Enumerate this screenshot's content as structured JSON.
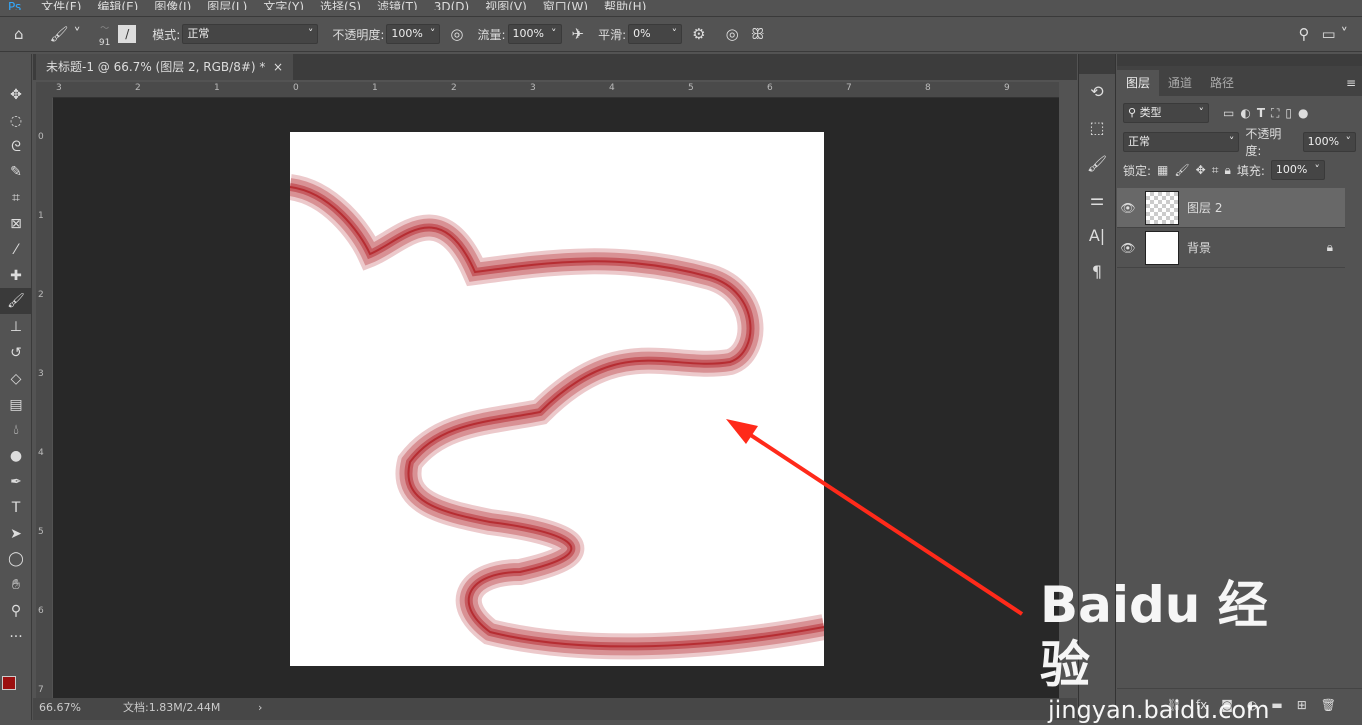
{
  "menu": [
    "文件(F)",
    "编辑(E)",
    "图像(I)",
    "图层(L)",
    "文字(Y)",
    "选择(S)",
    "滤镜(T)",
    "3D(D)",
    "视图(V)",
    "窗口(W)",
    "帮助(H)"
  ],
  "options": {
    "brush_size": "91",
    "mode_label": "模式:",
    "mode_value": "正常",
    "opacity_label": "不透明度:",
    "opacity_value": "100%",
    "flow_label": "流量:",
    "flow_value": "100%",
    "smooth_label": "平滑:",
    "smooth_value": "0%"
  },
  "document": {
    "tab_title": "未标题-1 @ 66.7% (图层 2, RGB/8#) *",
    "close": "×"
  },
  "rulers": {
    "h": [
      "3",
      "2",
      "1",
      "0",
      "1",
      "2",
      "3",
      "4",
      "5",
      "6",
      "7",
      "8",
      "9"
    ],
    "v": [
      "0",
      "1",
      "2",
      "3",
      "4",
      "5",
      "6",
      "7"
    ]
  },
  "status": {
    "zoom": "66.67%",
    "doc": "文档:1.83M/2.44M",
    "arrow": "›"
  },
  "layers_panel": {
    "tabs": [
      "图层",
      "通道",
      "路径"
    ],
    "filter": "类型",
    "blend": "正常",
    "opacity_label": "不透明度:",
    "opacity": "100%",
    "lock_label": "锁定:",
    "fill_label": "填充:",
    "fill": "100%",
    "layers": [
      {
        "name": "图层 2",
        "selected": true
      },
      {
        "name": "背景",
        "locked": true
      }
    ]
  },
  "colors": {
    "foreground": "#9b1010",
    "background": "#ffffff",
    "ribbon": "#b4282e",
    "arrow": "#ff2a1a"
  },
  "watermark": {
    "brand": "Baidu 经验",
    "url": "jingyan.baidu.com"
  }
}
